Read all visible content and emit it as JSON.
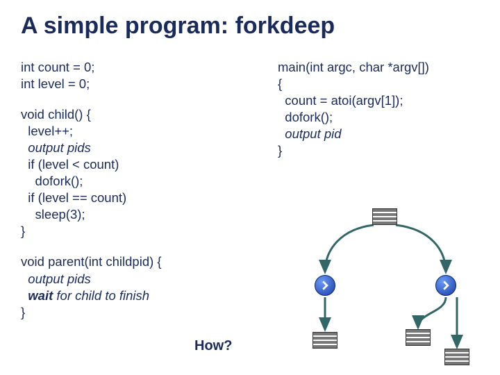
{
  "title": "A simple program: forkdeep",
  "left": {
    "decls": "int count = 0;\nint level = 0;",
    "child_head": "void child() {\n  level++;",
    "child_out": "  output pids",
    "child_tail": "  if (level < count)\n    dofork();\n  if (level == count)\n    sleep(3);\n}",
    "parent_head": "void parent(int childpid) {",
    "parent_out": "  output pids",
    "parent_wait": "  wait",
    "parent_wait_rest": " for child to finish",
    "parent_close": "}"
  },
  "right": {
    "main_head": "main(int argc, char *argv[])\n{\n  count = atoi(argv[1]);\n  dofork();",
    "main_out": "  output pid",
    "main_close": "}"
  },
  "how_label": "How?"
}
